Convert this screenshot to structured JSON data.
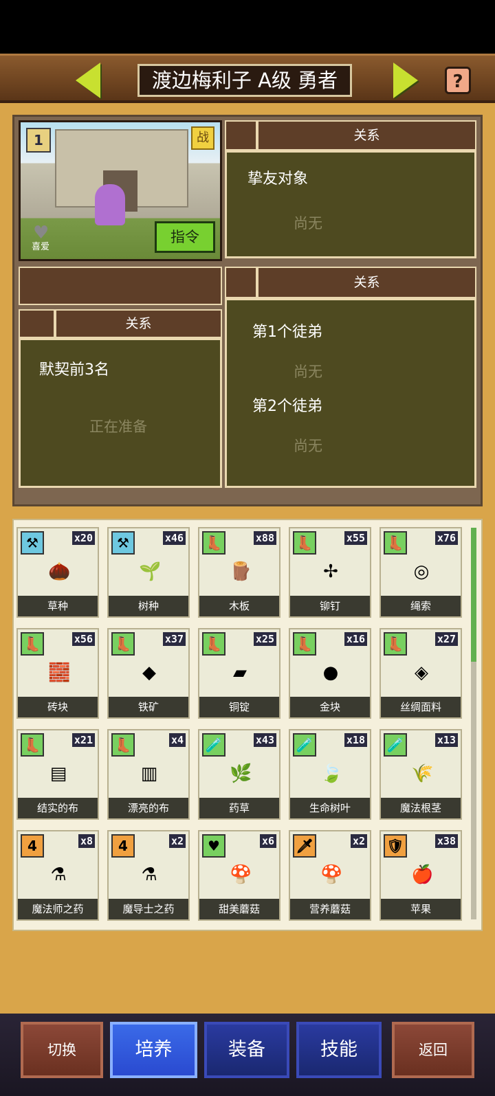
{
  "header": {
    "title": "渡边梅利子 A级 勇者",
    "help_label": "?"
  },
  "portrait": {
    "rank_badge": "1",
    "battle_badge": "战",
    "like_label": "喜爱",
    "command_button": "指令"
  },
  "panels": {
    "friend": {
      "header": "关系",
      "title": "挚友对象",
      "value": "尚无"
    },
    "blank_header": "",
    "contract": {
      "header": "关系",
      "title": "默契前3名",
      "value": "正在准备"
    },
    "disciples": {
      "header": "关系",
      "first_title": "第1个徒弟",
      "first_value": "尚无",
      "second_title": "第2个徒弟",
      "second_value": "尚无"
    }
  },
  "inventory": [
    {
      "name": "草种",
      "count": "x20",
      "badge": "hammer",
      "badge_color": "#6ec8e0",
      "icon": "seed-icon",
      "glyph": "🌰"
    },
    {
      "name": "树种",
      "count": "x46",
      "badge": "hammer",
      "badge_color": "#6ec8e0",
      "icon": "sprout-icon",
      "glyph": "🌱"
    },
    {
      "name": "木板",
      "count": "x88",
      "badge": "boot",
      "badge_color": "#78d060",
      "icon": "plank-icon",
      "glyph": "🪵"
    },
    {
      "name": "铆钉",
      "count": "x55",
      "badge": "boot",
      "badge_color": "#78d060",
      "icon": "rivet-icon",
      "glyph": "✢"
    },
    {
      "name": "绳索",
      "count": "x76",
      "badge": "boot",
      "badge_color": "#78d060",
      "icon": "rope-icon",
      "glyph": "◎"
    },
    {
      "name": "砖块",
      "count": "x56",
      "badge": "boot",
      "badge_color": "#78d060",
      "icon": "brick-icon",
      "glyph": "🧱"
    },
    {
      "name": "铁矿",
      "count": "x37",
      "badge": "boot",
      "badge_color": "#78d060",
      "icon": "iron-ore-icon",
      "glyph": "◆"
    },
    {
      "name": "铜锭",
      "count": "x25",
      "badge": "boot",
      "badge_color": "#78d060",
      "icon": "copper-ingot-icon",
      "glyph": "▰"
    },
    {
      "name": "金块",
      "count": "x16",
      "badge": "boot",
      "badge_color": "#78d060",
      "icon": "gold-nugget-icon",
      "glyph": "●"
    },
    {
      "name": "丝绸面料",
      "count": "x27",
      "badge": "boot",
      "badge_color": "#78d060",
      "icon": "silk-cloth-icon",
      "glyph": "◈"
    },
    {
      "name": "结实的布",
      "count": "x21",
      "badge": "boot",
      "badge_color": "#78d060",
      "icon": "sturdy-cloth-icon",
      "glyph": "▤"
    },
    {
      "name": "漂亮的布",
      "count": "x4",
      "badge": "boot",
      "badge_color": "#78d060",
      "icon": "pretty-cloth-icon",
      "glyph": "▥"
    },
    {
      "name": "药草",
      "count": "x43",
      "badge": "potion",
      "badge_color": "#78d060",
      "icon": "herb-icon",
      "glyph": "🌿"
    },
    {
      "name": "生命树叶",
      "count": "x18",
      "badge": "potion",
      "badge_color": "#78d060",
      "icon": "life-leaf-icon",
      "glyph": "🍃"
    },
    {
      "name": "魔法根茎",
      "count": "x13",
      "badge": "potion",
      "badge_color": "#78d060",
      "icon": "magic-root-icon",
      "glyph": "🌾"
    },
    {
      "name": "魔法师之药",
      "count": "x8",
      "badge": "4",
      "badge_color": "#f0a040",
      "icon": "mage-potion-icon",
      "glyph": "⚗"
    },
    {
      "name": "魔导士之药",
      "count": "x2",
      "badge": "4",
      "badge_color": "#f0a040",
      "icon": "sorcerer-potion-icon",
      "glyph": "⚗"
    },
    {
      "name": "甜美蘑菇",
      "count": "x6",
      "badge": "heart",
      "badge_color": "#78d060",
      "icon": "sweet-mushroom-icon",
      "glyph": "🍄"
    },
    {
      "name": "营养蘑菇",
      "count": "x2",
      "badge": "sword",
      "badge_color": "#f0a040",
      "icon": "nutrition-mushroom-icon",
      "glyph": "🍄"
    },
    {
      "name": "苹果",
      "count": "x38",
      "badge": "shield",
      "badge_color": "#f0a040",
      "icon": "apple-icon",
      "glyph": "🍎"
    }
  ],
  "nav": {
    "switch": "切换",
    "train": "培养",
    "equip": "装备",
    "skill": "技能",
    "back": "返回"
  },
  "colors": {
    "accent_green": "#c8e030",
    "panel_olive": "#4e4a20",
    "active_tab": "#3a6ae8"
  }
}
